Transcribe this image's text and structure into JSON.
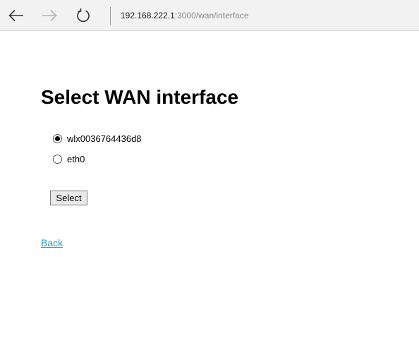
{
  "browser": {
    "url_host": "192.168.222.1",
    "url_path": ":3000/wan/interface",
    "icons": {
      "back": "arrow-left-icon",
      "forward": "arrow-right-icon",
      "reload": "reload-icon"
    }
  },
  "page": {
    "title": "Select WAN interface",
    "interfaces": [
      {
        "label": "wlx0036764436d8",
        "selected": true
      },
      {
        "label": "eth0",
        "selected": false
      }
    ],
    "select_button": "Select",
    "back_link": "Back"
  },
  "colors": {
    "link": "#1a9fd9",
    "toolbar_bg": "#f2f2f2"
  }
}
